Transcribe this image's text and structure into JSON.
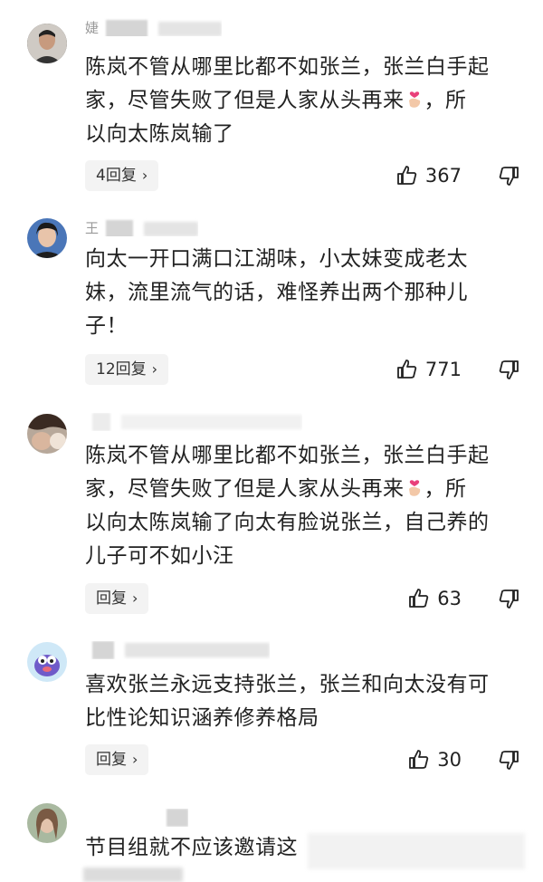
{
  "comments": [
    {
      "text_lines": [
        "陈岚不管从哪里比都不如张兰，张兰白手起",
        "家，尽管失败了但是人家从头再来",
        "，所",
        "以向太陈岚输了"
      ],
      "reply_label": "4回复",
      "likes": "367",
      "avatar_color": "#3d3a37"
    },
    {
      "text_lines": [
        "向太一开口满口江湖味，小太妹变成老太",
        "妹，流里流气的话，难怪养出两个那种儿",
        "子！"
      ],
      "reply_label": "12回复",
      "likes": "771",
      "avatar_color": "#4a76b8"
    },
    {
      "text_lines": [
        "陈岚不管从哪里比都不如张兰，张兰白手起",
        "家，尽管失败了但是人家从头再来",
        "，所",
        "以向太陈岚输了向太有脸说张兰，自己养的",
        "儿子可不如小汪"
      ],
      "reply_label": "回复",
      "likes": "63",
      "avatar_color": "#7a5c4c"
    },
    {
      "text_lines": [
        "喜欢张兰永远支持张兰，张兰和向太没有可",
        "比性论知识涵养修养格局"
      ],
      "reply_label": "回复",
      "likes": "30",
      "avatar_color": "#6fb6e6"
    },
    {
      "text_lines": [
        "节目组就不应该邀请这"
      ],
      "avatar_color": "#9c8a7e"
    }
  ],
  "names": [
    "婕",
    "王",
    "",
    "",
    ""
  ]
}
